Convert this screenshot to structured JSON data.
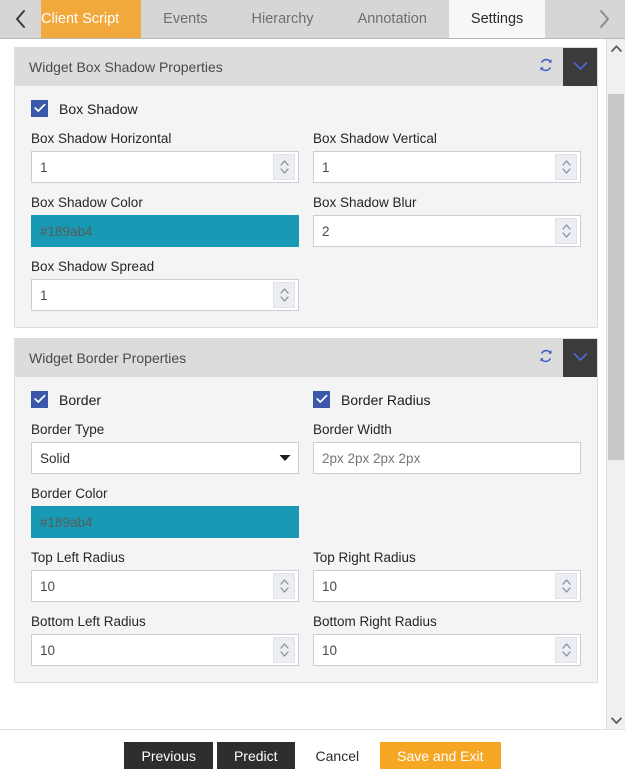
{
  "tabs": {
    "prev_icon": "chevron-left-icon",
    "next_icon": "chevron-right-icon",
    "items": [
      {
        "label": "Client Script",
        "state": "highlight"
      },
      {
        "label": "Events",
        "state": "normal"
      },
      {
        "label": "Hierarchy",
        "state": "normal"
      },
      {
        "label": "Annotation",
        "state": "normal"
      },
      {
        "label": "Settings",
        "state": "active"
      }
    ]
  },
  "panels": [
    {
      "title": "Widget Box Shadow Properties",
      "refresh_icon": "refresh-icon",
      "collapse_icon": "chevron-down-icon",
      "checkbox": {
        "label": "Box Shadow",
        "checked": true
      },
      "fields": [
        {
          "label": "Box Shadow Horizontal",
          "value": "1",
          "type": "number"
        },
        {
          "label": "Box Shadow Vertical",
          "value": "1",
          "type": "number"
        },
        {
          "label": "Box Shadow Color",
          "value": "#189ab4",
          "type": "color"
        },
        {
          "label": "Box Shadow Blur",
          "value": "2",
          "type": "number"
        },
        {
          "label": "Box Shadow Spread",
          "value": "1",
          "type": "number"
        }
      ]
    },
    {
      "title": "Widget Border Properties",
      "refresh_icon": "refresh-icon",
      "collapse_icon": "chevron-down-icon",
      "checkbox": {
        "label": "Border",
        "checked": true
      },
      "checkbox2": {
        "label": "Border Radius",
        "checked": true
      },
      "fields": [
        {
          "label": "Border Type",
          "value": "Solid",
          "type": "select"
        },
        {
          "label": "Border Width",
          "value": "2px 2px 2px 2px",
          "type": "text"
        },
        {
          "label": "Border Color",
          "value": "#189ab4",
          "type": "color"
        },
        {
          "label": "Top Left Radius",
          "value": "10",
          "type": "number"
        },
        {
          "label": "Top Right Radius",
          "value": "10",
          "type": "number"
        },
        {
          "label": "Bottom Left Radius",
          "value": "10",
          "type": "number"
        },
        {
          "label": "Bottom Right Radius",
          "value": "10",
          "type": "number"
        }
      ]
    }
  ],
  "scrollbar": {
    "up_icon": "chevron-up-icon",
    "down_icon": "chevron-down-icon"
  },
  "footer": {
    "previous": "Previous",
    "predict": "Predict",
    "cancel": "Cancel",
    "save_and_exit": "Save and Exit"
  },
  "colors": {
    "accent_orange": "#f5a623",
    "teal_swatch": "#189ab4",
    "checkbox_blue": "#3a57a8",
    "dark_button": "#2e2e2e"
  }
}
